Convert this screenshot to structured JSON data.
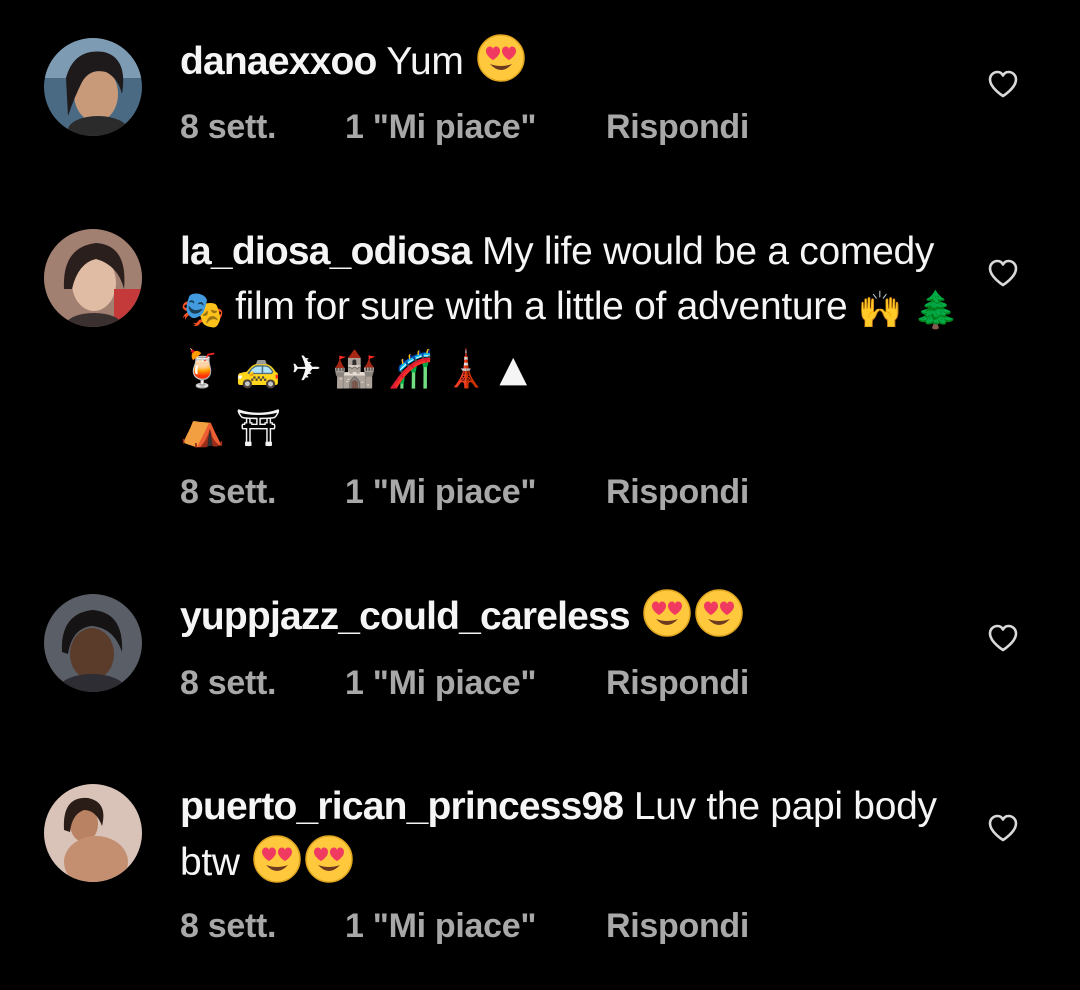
{
  "comments": [
    {
      "username": "danaexxoo",
      "text": "Yum",
      "emoji_trailing": "heart-eyes",
      "time": "8 sett.",
      "likes": "1 \"Mi piace\"",
      "reply": "Rispondi"
    },
    {
      "username": "la_diosa_odiosa",
      "text": "My life would be a comedy 🎭 film for sure with a little of adventure 🙌 🌲 🍹 🚕 ✈️ 🏰🎢 🗼 ▲ ⛺ ⛩",
      "text_part1": "My life would be a comedy ",
      "emoji_mask": "🎭",
      "text_part2": " film for sure with a little of adventure ",
      "emoji_line": "🙌 🌲 🍹 🚕 ✈ 🏰 🎢 🗼 ▲",
      "emoji_line2": "⛺ ⛩",
      "time": "8 sett.",
      "likes": "1 \"Mi piace\"",
      "reply": "Rispondi"
    },
    {
      "username": "yuppjazz_could_careless",
      "text": "",
      "emoji_trailing": "heart-eyes x2",
      "time": "8 sett.",
      "likes": "1 \"Mi piace\"",
      "reply": "Rispondi"
    },
    {
      "username": "puerto_rican_princess98",
      "text": "Luv the papi body btw",
      "emoji_trailing": "heart-eyes x2",
      "time": "8 sett.",
      "likes": "1 \"Mi piace\"",
      "reply": "Rispondi"
    }
  ],
  "icons": {
    "like": "heart-outline-icon",
    "emoji": "smiling-face-with-heart-eyes-icon"
  },
  "colors": {
    "background": "#000000",
    "text": "#f5f5f5",
    "meta": "#a8a8a8",
    "emoji_face": "#ffc83d",
    "emoji_heart": "#f03a5f"
  }
}
